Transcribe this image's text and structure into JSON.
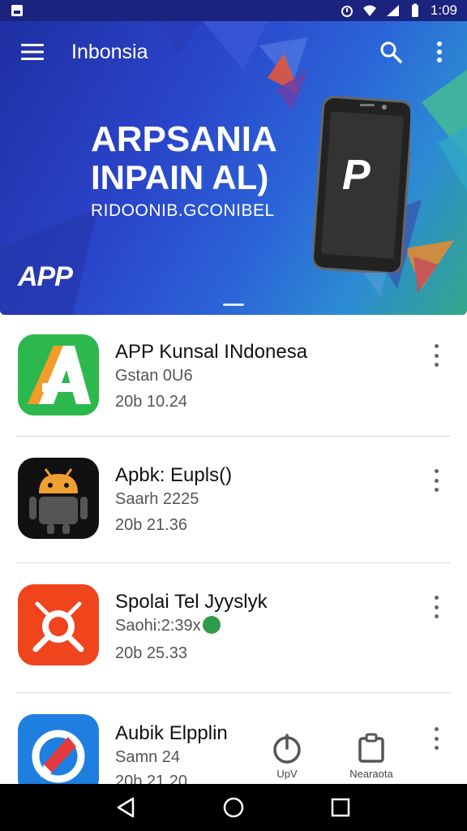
{
  "status_bar": {
    "time": "1:09"
  },
  "app_bar": {
    "title": "Inbonsia"
  },
  "hero": {
    "line1": "ARPSANIA",
    "line2": "INPAIN AL)",
    "line3": "RIDOONIB.GCONIBEL",
    "brand": "APP",
    "phone_logo": "P"
  },
  "apps": [
    {
      "name": "APP Kunsal INdonesa",
      "sub": "Gstan 0U6",
      "date": "20b 10.24",
      "icon": "letter-a-icon",
      "color": "#2db84d"
    },
    {
      "name": "Apbk: Eupls()",
      "sub": "Saarh 2225",
      "date": "20b 21.36",
      "icon": "android-icon",
      "color": "#111111"
    },
    {
      "name": "Spolai Tel Jyyslyk",
      "sub": "Saohi:2:39x",
      "date": "20b 25.33",
      "icon": "crosshair-icon",
      "color": "#f0441c"
    },
    {
      "name": "Aubik Elpplin",
      "sub": "Samn 24",
      "date": "20b 21.20",
      "icon": "compass-icon",
      "color": "#1e7fe0"
    }
  ],
  "floating_actions": [
    {
      "label": "UpV",
      "icon": "power-icon"
    },
    {
      "label": "Nearaota",
      "icon": "clipboard-icon"
    }
  ],
  "nav": {
    "back": "back-icon",
    "home": "home-icon",
    "recents": "recents-icon"
  }
}
